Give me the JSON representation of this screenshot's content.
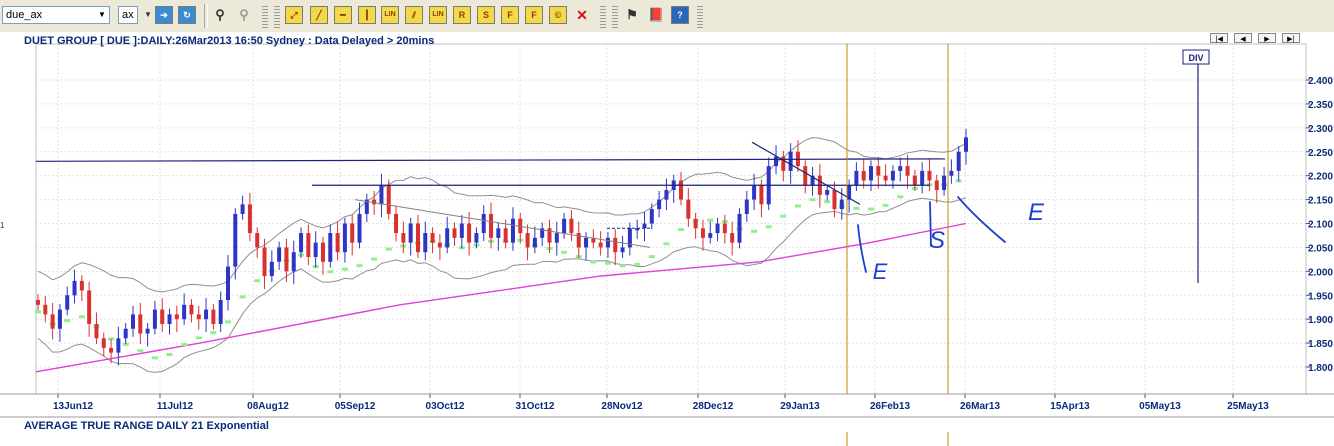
{
  "toolbar": {
    "symbol_value": "due_ax",
    "exchange_value": "ax",
    "icons": [
      "arrow-right-icon",
      "refresh-icon",
      "binoculars-icon",
      "binoculars-gray-icon",
      "trend-line-icon",
      "line-icon",
      "horizontal-line-icon",
      "vertical-line-icon",
      "lin-tool-icon",
      "channel-icon",
      "lin-tool-2-icon",
      "r-tool-icon",
      "s-tool-icon",
      "f-tool-icon",
      "f2-tool-icon",
      "copyright-tool-icon",
      "delete-icon",
      "flag-icon",
      "book-icon",
      "help-icon"
    ],
    "button_glyphs": {
      "lin": "LIN",
      "r": "R",
      "s": "S",
      "f": "F",
      "f2": "F",
      "help": "?",
      "delete": "✕",
      "copy": "©"
    }
  },
  "header": {
    "title": "DUET GROUP [ DUE ]:DAILY:26Mar2013 16:50 Sydney : Data Delayed > 20mins",
    "div_label": "DIV",
    "left_marker": "1"
  },
  "footer": {
    "indicator_label": "AVERAGE TRUE RANGE DAILY 21 Exponential"
  },
  "chart_data": {
    "type": "candlestick",
    "title": "DUET GROUP [ DUE ]:DAILY:26Mar2013 16:50 Sydney : Data Delayed > 20mins",
    "x_tick_labels": [
      "13Jun12",
      "11Jul12",
      "08Aug12",
      "05Sep12",
      "03Oct12",
      "31Oct12",
      "28Nov12",
      "28Dec12",
      "29Jan13",
      "26Feb13",
      "26Mar13",
      "15Apr13",
      "05May13",
      "25May13"
    ],
    "y_tick_labels": [
      "2.400",
      "2.350",
      "2.300",
      "2.250",
      "2.200",
      "2.150",
      "2.100",
      "2.050",
      "2.000",
      "1.950",
      "1.900",
      "1.850",
      "1.800"
    ],
    "ylim": [
      1.75,
      2.42
    ],
    "colors": {
      "up": "#2c35c4",
      "down": "#d93030",
      "ma": "#e040d8",
      "trend": "#1a237e",
      "support": "#8ef08e",
      "bands": "#909090",
      "vline": "#c8860a",
      "annot": "#1f3fd0"
    },
    "annotation_texts": [
      "E",
      "S",
      "E"
    ],
    "close_prices": [
      1.93,
      1.91,
      1.88,
      1.92,
      1.95,
      1.98,
      1.96,
      1.89,
      1.86,
      1.84,
      1.83,
      1.86,
      1.88,
      1.91,
      1.87,
      1.88,
      1.92,
      1.89,
      1.91,
      1.9,
      1.93,
      1.91,
      1.9,
      1.92,
      1.89,
      1.94,
      2.01,
      2.12,
      2.14,
      2.08,
      2.05,
      1.99,
      2.02,
      2.05,
      2.0,
      2.04,
      2.08,
      2.03,
      2.06,
      2.02,
      2.08,
      2.04,
      2.1,
      2.06,
      2.12,
      2.15,
      2.14,
      2.18,
      2.12,
      2.08,
      2.06,
      2.1,
      2.04,
      2.08,
      2.06,
      2.05,
      2.09,
      2.07,
      2.1,
      2.06,
      2.08,
      2.12,
      2.07,
      2.09,
      2.06,
      2.11,
      2.08,
      2.05,
      2.07,
      2.09,
      2.06,
      2.08,
      2.11,
      2.08,
      2.05,
      2.07,
      2.06,
      2.05,
      2.07,
      2.04,
      2.05,
      2.09,
      2.09,
      2.1,
      2.13,
      2.15,
      2.17,
      2.19,
      2.15,
      2.11,
      2.09,
      2.07,
      2.08,
      2.1,
      2.08,
      2.06,
      2.12,
      2.15,
      2.18,
      2.14,
      2.22,
      2.24,
      2.21,
      2.25,
      2.22,
      2.18,
      2.2,
      2.16,
      2.17,
      2.13,
      2.15,
      2.18,
      2.21,
      2.19,
      2.22,
      2.2,
      2.19,
      2.21,
      2.22,
      2.2,
      2.18,
      2.21,
      2.19,
      2.17,
      2.2,
      2.21,
      2.25,
      2.28
    ]
  }
}
